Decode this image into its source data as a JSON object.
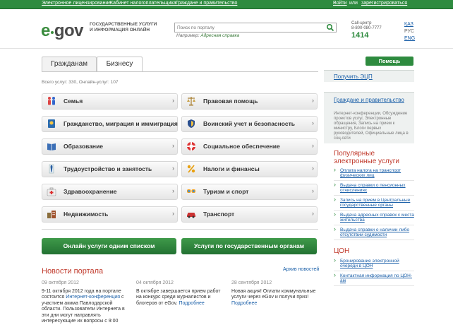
{
  "topbar": {
    "links": [
      "Электронное лицензирование",
      "Кабинет налогоплательщика",
      "Граждане и правительство"
    ],
    "login": "Войти",
    "or": "или",
    "register": "зарегистрироваться"
  },
  "header": {
    "logo_e": "e",
    "logo_gov": "gov",
    "slogan": "ГОСУДАРСТВЕННЫЕ УСЛУГИ И ИНФОРМАЦИЯ ОНЛАЙН",
    "search_placeholder": "Поиск по порталу",
    "search_hint_prefix": "Например:",
    "search_hint_link": "Адресная справка",
    "callcenter_label": "Call-центр",
    "callcenter_phone": "8-800-080-7777",
    "callcenter_short": "1414",
    "languages": [
      "ҚАЗ",
      "РУС",
      "ENG"
    ]
  },
  "tabs": [
    "Гражданам",
    "Бизнесу"
  ],
  "stats": "Всего услуг: 330, Онлайн-услуг: 107",
  "categories": [
    {
      "label": "Семья",
      "icon": "family-icon"
    },
    {
      "label": "Правовая помощь",
      "icon": "scales-icon"
    },
    {
      "label": "Гражданство, миграция и иммиграция",
      "icon": "passport-icon"
    },
    {
      "label": "Воинский учет и безопасность",
      "icon": "shield-icon"
    },
    {
      "label": "Образование",
      "icon": "book-icon"
    },
    {
      "label": "Социальное обеспечение",
      "icon": "lifebuoy-icon"
    },
    {
      "label": "Трудоустройство и занятость",
      "icon": "tie-icon"
    },
    {
      "label": "Налоги и финансы",
      "icon": "percent-icon"
    },
    {
      "label": "Здравоохранение",
      "icon": "medkit-icon"
    },
    {
      "label": "Туризм и спорт",
      "icon": "goggles-icon"
    },
    {
      "label": "Недвижимость",
      "icon": "buildings-icon"
    },
    {
      "label": "Транспорт",
      "icon": "car-icon"
    }
  ],
  "buttons": {
    "online_list": "Онлайн услуги одним списком",
    "by_agency": "Услуги по государственным органам"
  },
  "news": {
    "title": "Новости портала",
    "archive": "Архив новостей",
    "items": [
      {
        "date": "09 октября 2012",
        "text": "9-11 октября 2012 года на портале состоится",
        "link": "Интернет-конференция",
        "text2": "с участием акима Павлодарской области. Пользователи Интернета в эти дни могут направлять интересующие их вопросы с 9:00"
      },
      {
        "date": "04 октября 2012",
        "text": "В октябре завершается прием работ на конкурс среди журналистов и блогеров от eGov.",
        "link": "Подробнее",
        "text2": ""
      },
      {
        "date": "28 сентября 2012",
        "text": "Новая акция! Оплати коммунальные услуги через eGov и получи приз!",
        "link": "Подробнее",
        "text2": ""
      }
    ]
  },
  "right": {
    "help": "Помощь",
    "get_eds": "Получить ЭЦП",
    "gov_title": "Граждане и правительство",
    "gov_text": "Интернет-конференции, Обсуждение проектов услуг, Электронные обращения, Запись на прием к министру, Блоги первых руководителей, Официальные лица в соц.сети",
    "popular_title": "Популярные электронные услуги",
    "popular": [
      "Оплата налога на транспорт физических лиц",
      "Выдача справки о пенсионных отчислениях",
      "Запись на прием в Центральные государственные органы",
      "Выдача адресных справок с места жительства",
      "Выдача справки о наличии либо отсутствии судимости"
    ],
    "con_title": "ЦОН",
    "con": [
      "Бронирование электронной очереди в ЦОН",
      "Контактная информация по ЦОН-ам"
    ]
  },
  "colors": {
    "brand_green": "#2e8b3f",
    "heading_red": "#c0392b",
    "link_blue": "#1a5fa8"
  }
}
